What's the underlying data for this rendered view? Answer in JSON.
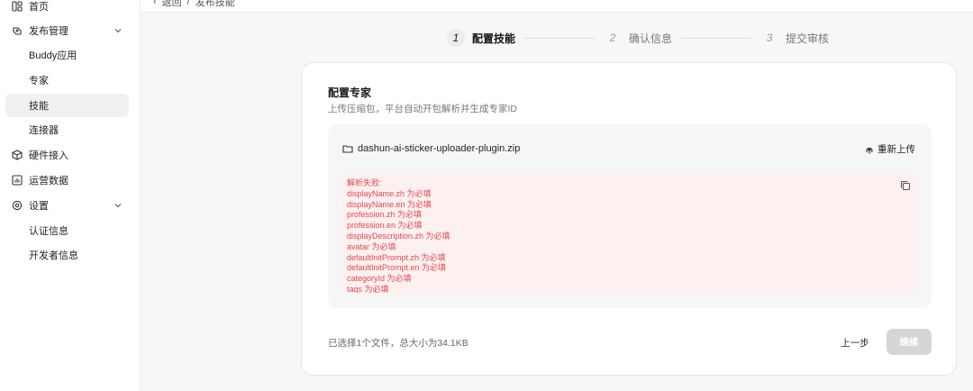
{
  "sidebar": {
    "items": [
      {
        "label": "首页",
        "icon": "dashboard-icon"
      },
      {
        "label": "发布管理",
        "icon": "publish-icon"
      },
      {
        "label": "Buddy应用"
      },
      {
        "label": "专家"
      },
      {
        "label": "技能"
      },
      {
        "label": "连接器"
      },
      {
        "label": "硬件接入",
        "icon": "cube-icon"
      },
      {
        "label": "运营数据",
        "icon": "chart-icon"
      },
      {
        "label": "设置",
        "icon": "settings-icon"
      },
      {
        "label": "认证信息"
      },
      {
        "label": "开发者信息"
      }
    ]
  },
  "topbar": {
    "back_label": "返回",
    "title": "发布技能"
  },
  "steps": [
    {
      "num": "1",
      "label": "配置技能"
    },
    {
      "num": "2",
      "label": "确认信息"
    },
    {
      "num": "3",
      "label": "提交审核"
    }
  ],
  "card": {
    "title": "配置专家",
    "subtitle": "上传压缩包，平台自动开包解析并生成专家ID",
    "file_name": "dashun-ai-sticker-uploader-plugin.zip",
    "reupload_label": "重新上传",
    "error_lines": [
      "解析失败:",
      "displayName.zh 为必填",
      "displayName.en 为必填",
      "profession.zh 为必填",
      "profession.en 为必填",
      "displayDescription.zh 为必填",
      "avatar 为必填",
      "defaultInitPrompt.zh 为必填",
      "defaultInitPrompt.en 为必填",
      "categoryId 为必填",
      "tags 为必填"
    ],
    "footer_info": "已选择1个文件，总大小为34.1KB",
    "prev_label": "上一步",
    "next_label": "继续"
  },
  "colors": {
    "error_text": "#e5484d",
    "error_bg": "#fdf0f0",
    "disabled_button": "#d6d6d6",
    "active_nav_bg": "#f1f1f1"
  }
}
